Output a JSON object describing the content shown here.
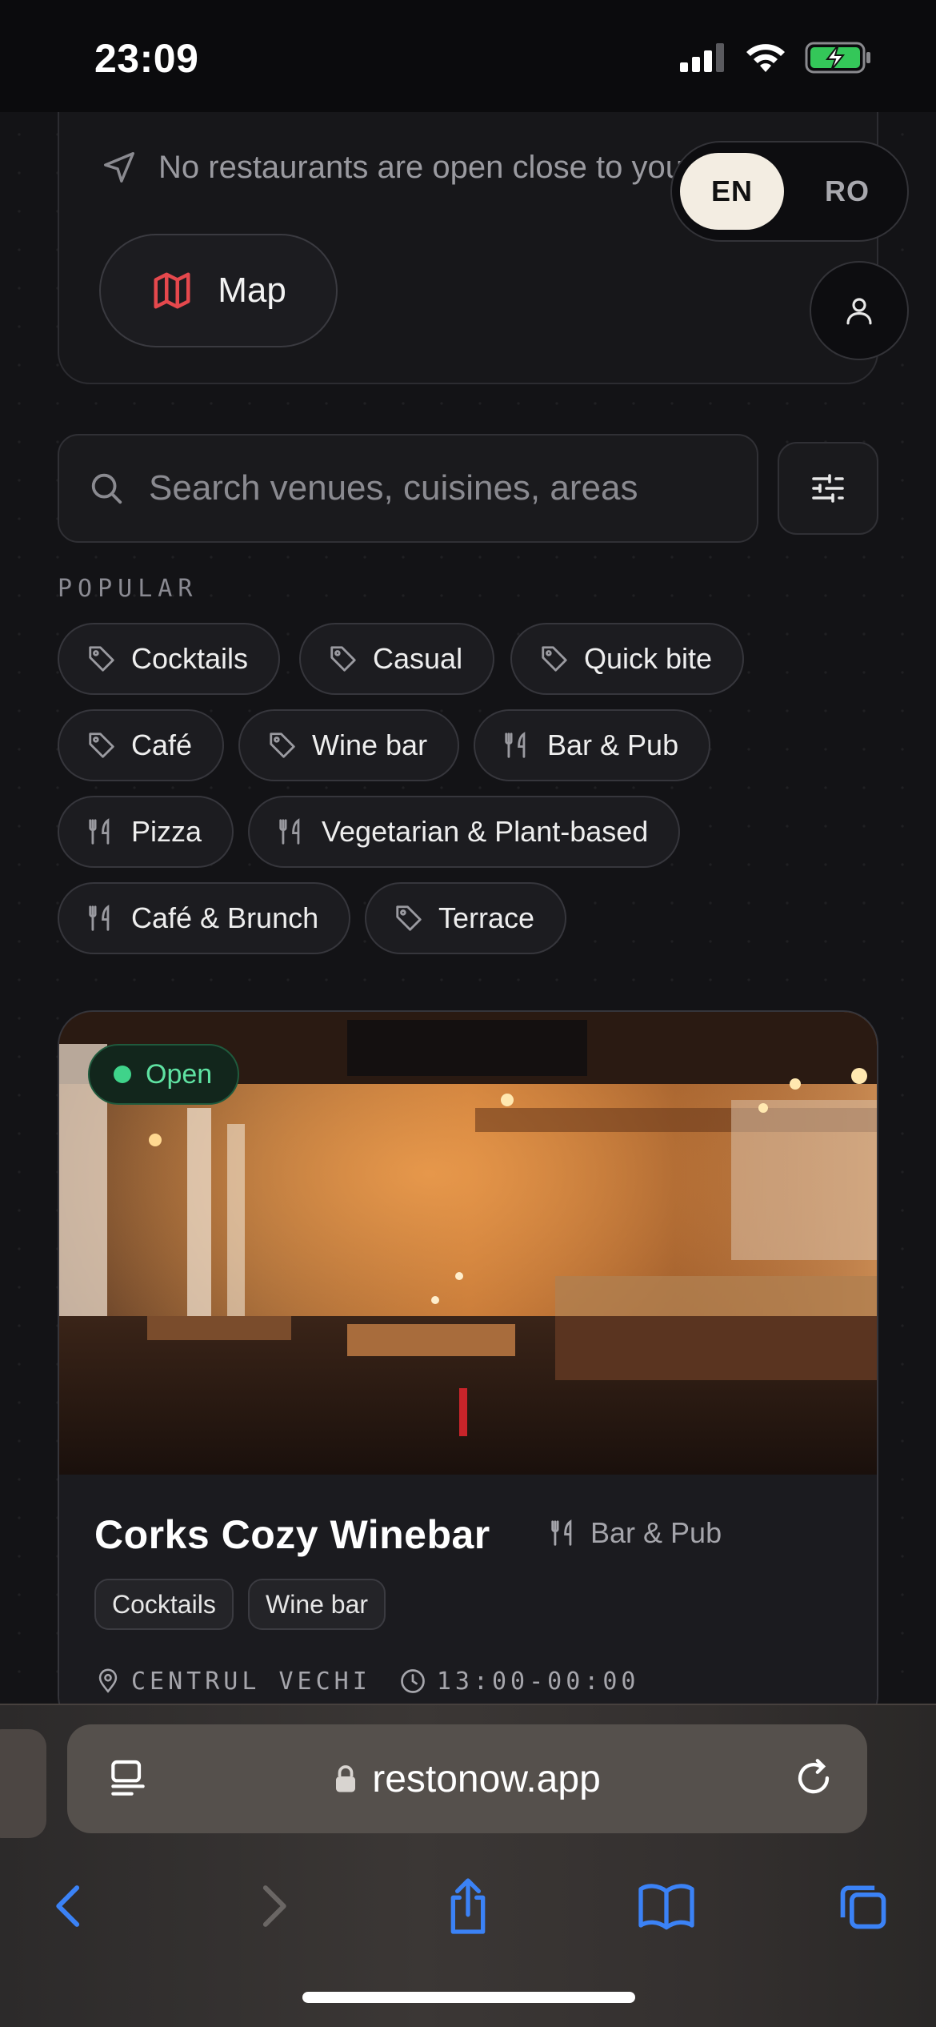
{
  "status_bar": {
    "time": "23:09"
  },
  "nearby": {
    "message": "No restaurants are open close to you",
    "map_label": "Map"
  },
  "language": {
    "options": [
      "EN",
      "RO"
    ],
    "selected": "EN"
  },
  "search": {
    "placeholder": "Search venues, cuisines, areas"
  },
  "popular": {
    "title": "POPULAR",
    "chips": [
      {
        "label": "Cocktails",
        "icon": "tag-icon"
      },
      {
        "label": "Casual",
        "icon": "tag-icon"
      },
      {
        "label": "Quick bite",
        "icon": "tag-icon"
      },
      {
        "label": "Café",
        "icon": "tag-icon"
      },
      {
        "label": "Wine bar",
        "icon": "tag-icon"
      },
      {
        "label": "Bar & Pub",
        "icon": "utensils-icon"
      },
      {
        "label": "Pizza",
        "icon": "utensils-icon"
      },
      {
        "label": "Vegetarian & Plant-based",
        "icon": "utensils-icon"
      },
      {
        "label": "Café & Brunch",
        "icon": "utensils-icon"
      },
      {
        "label": "Terrace",
        "icon": "tag-icon"
      }
    ]
  },
  "venue": {
    "status": "Open",
    "name": "Corks Cozy Winebar",
    "category": "Bar & Pub",
    "tags": [
      "Cocktails",
      "Wine bar"
    ],
    "area": "CENTRUL VECHI",
    "hours": "13:00-00:00"
  },
  "browser": {
    "url": "restonow.app"
  },
  "colors": {
    "accent_map": "#e5484d",
    "open_green": "#3fd38a",
    "ios_blue": "#3b82f6"
  }
}
